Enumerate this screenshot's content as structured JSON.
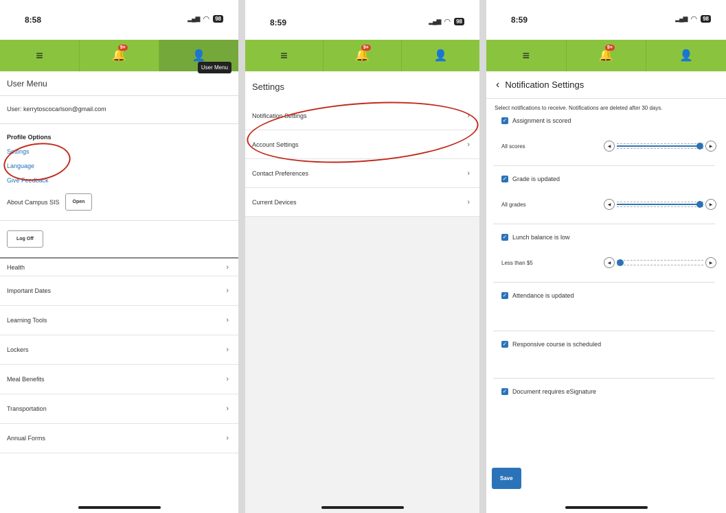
{
  "screen1": {
    "time": "8:58",
    "battery": "98",
    "badge": "9+",
    "tooltip": "User Menu",
    "menu_title": "User Menu",
    "user_line": "User: kerrytoscocarlson@gmail.com",
    "profile_heading": "Profile Options",
    "links": [
      "Settings",
      "Language",
      "Give Feedback"
    ],
    "about_label": "About Campus SIS",
    "open_label": "Open",
    "logoff_label": "Log Off",
    "list": [
      "Health",
      "Important Dates",
      "Learning Tools",
      "Lockers",
      "Meal Benefits",
      "Transportation",
      "Annual Forms"
    ]
  },
  "screen2": {
    "time": "8:59",
    "battery": "98",
    "badge": "9+",
    "title": "Settings",
    "list": [
      "Notification Settings",
      "Account Settings",
      "Contact Preferences",
      "Current Devices"
    ]
  },
  "screen3": {
    "time": "8:59",
    "battery": "98",
    "badge": "9+",
    "title": "Notification Settings",
    "description": "Select notifications to receive. Notifications are deleted after 30 days.",
    "items": [
      {
        "label": "Assignment is scored",
        "slider_label": "All scores",
        "level": 1.0
      },
      {
        "label": "Grade is updated",
        "slider_label": "All grades",
        "level": 1.0
      },
      {
        "label": "Lunch balance is low",
        "slider_label": "Less than $5",
        "level": 0.0
      },
      {
        "label": "Attendance is updated"
      },
      {
        "label": "Responsive course is scheduled"
      },
      {
        "label": "Document requires eSignature"
      }
    ],
    "save_label": "Save"
  },
  "colors": {
    "nav_green": "#8ac43f",
    "link_blue": "#2470b8",
    "annotation_red": "#c22a1c",
    "badge_red": "#d9442a"
  }
}
